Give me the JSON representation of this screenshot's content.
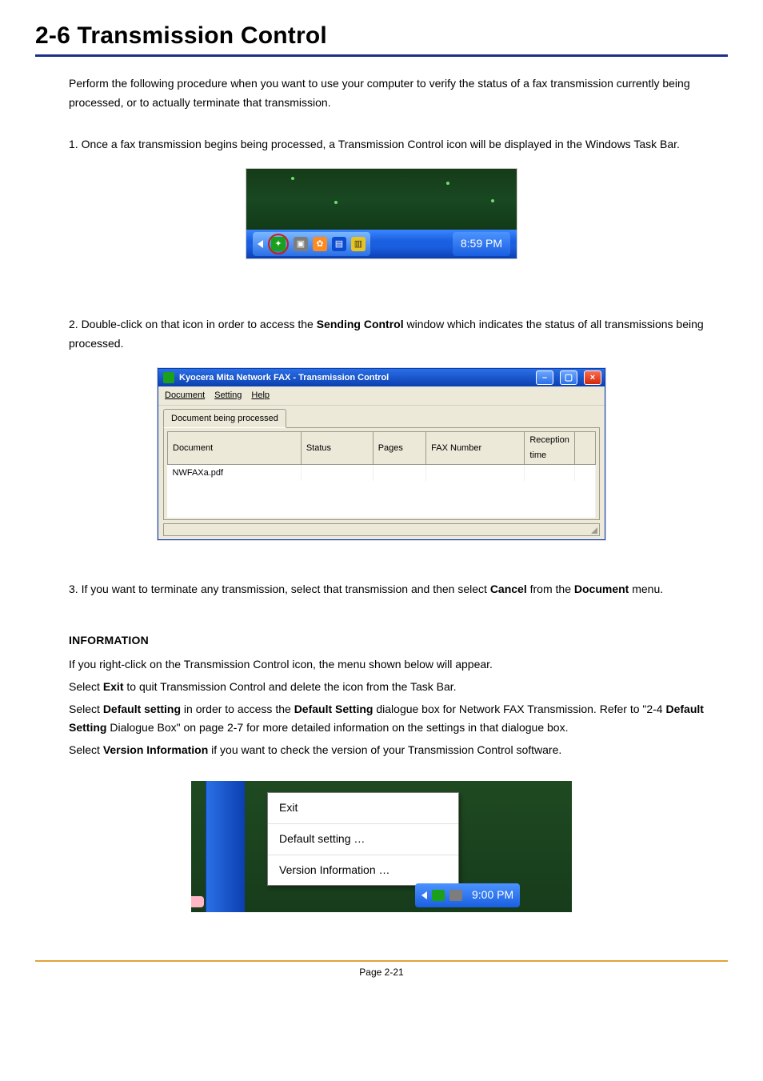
{
  "heading": "2-6  Transmission Control",
  "intro": "Perform the following procedure when you want to use your computer to verify the status of a fax transmission currently being processed, or to actually terminate that transmission.",
  "step1": "1. Once a fax transmission begins being processed, a Transmission Control icon will be displayed in the Windows Task Bar.",
  "fig1": {
    "time": "8:59 PM"
  },
  "step2": {
    "pre": "2. Double-click on that icon in order to access the ",
    "bold": "Sending Control",
    "post": " window which indicates the status of all transmissions being processed."
  },
  "fig2": {
    "title": "Kyocera Mita Network FAX - Transmission Control",
    "menus": {
      "m1": "Document",
      "m2": "Setting",
      "m3": "Help"
    },
    "tab": "Document being processed",
    "cols": {
      "c1": "Document",
      "c2": "Status",
      "c3": "Pages",
      "c4": "FAX Number",
      "c5": "Reception time"
    },
    "row1": "NWFAXa.pdf"
  },
  "step3": {
    "pre": "3. If you want to terminate any transmission, select that transmission and then select ",
    "bold1": "Cancel",
    "mid": " from the ",
    "bold2": "Document",
    "post": " menu."
  },
  "info": {
    "heading": "INFORMATION",
    "l1": "If you right-click on the Transmission Control icon, the menu shown below will appear.",
    "l2a": "Select ",
    "l2b": "Exit",
    "l2c": " to quit Transmission Control and delete the icon from the Task Bar.",
    "l3a": "Select ",
    "l3b": "Default setting",
    "l3c": " in order to access the ",
    "l3d": "Default Setting",
    "l3e": " dialogue box for Network FAX Transmission. Refer to \"2-4 ",
    "l3f": "Default Setting",
    "l3g": " Dialogue Box\" on page 2-7 for more detailed information on the settings in that dialogue box.",
    "l4a": "Select ",
    "l4b": "Version Information",
    "l4c": " if you want to check the version of your Transmission Control software."
  },
  "fig3": {
    "menu": {
      "m1": "Exit",
      "m2": "Default setting …",
      "m3": "Version Information …"
    },
    "time": "9:00 PM"
  },
  "footer": "Page 2-21"
}
